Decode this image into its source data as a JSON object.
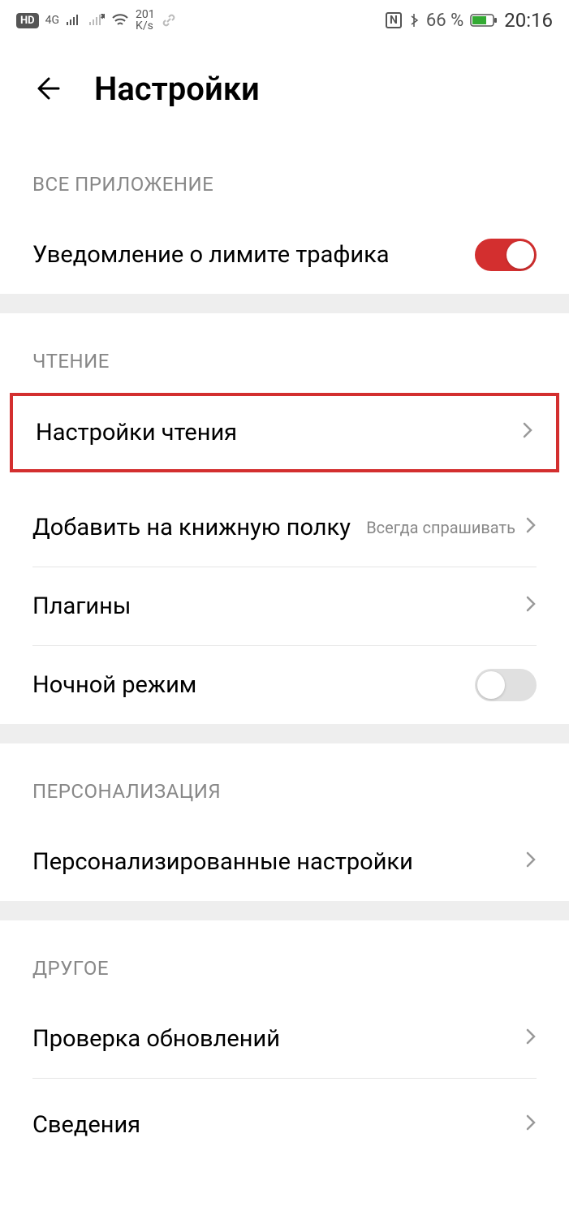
{
  "status": {
    "hd_label": "HD",
    "conn": "4G",
    "speed_num": "201",
    "speed_unit": "K/s",
    "nfc": "N",
    "battery_pct": "66 %",
    "time": "20:16"
  },
  "header": {
    "title": "Настройки"
  },
  "sections": {
    "all_app": {
      "header": "ВСЕ ПРИЛОЖЕНИЕ",
      "traffic_notice": "Уведомление о лимите трафика"
    },
    "reading": {
      "header": "ЧТЕНИЕ",
      "reading_settings": "Настройки чтения",
      "add_to_shelf": "Добавить на книжную полку",
      "add_to_shelf_value": "Всегда спрашивать",
      "plugins": "Плагины",
      "night_mode": "Ночной режим"
    },
    "personalization": {
      "header": "ПЕРСОНАЛИЗАЦИЯ",
      "personalized_settings": "Персонализированные настройки"
    },
    "other": {
      "header": "ДРУГОЕ",
      "check_updates": "Проверка обновлений",
      "about": "Сведения"
    }
  }
}
